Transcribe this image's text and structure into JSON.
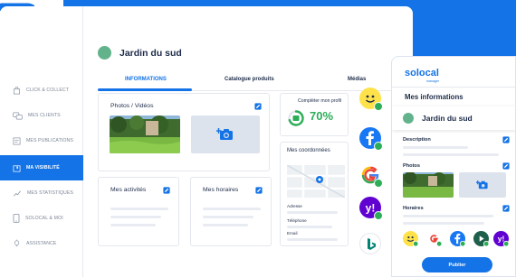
{
  "brand": {
    "accent": "#1473e6",
    "success": "#2cae58",
    "text": "#1d2b48"
  },
  "sidebar": {
    "items": [
      {
        "label": "Click & collect",
        "icon": "shopping-bag-icon"
      },
      {
        "label": "Mes clients",
        "icon": "chat-bubbles-icon"
      },
      {
        "label": "Mes publications",
        "icon": "publication-icon"
      },
      {
        "label": "Ma visibilité",
        "icon": "map-pin-icon",
        "active": true
      },
      {
        "label": "Mes statistiques",
        "icon": "chart-line-icon"
      },
      {
        "label": "Solocal & moi",
        "icon": "phone-icon"
      },
      {
        "label": "Assistance",
        "icon": "lightbulb-icon"
      }
    ]
  },
  "header": {
    "title": "Jardin du sud"
  },
  "tabs": [
    "INFORMATIONS",
    "Catalogue produits",
    "Médias"
  ],
  "cards": {
    "photos": {
      "title": "Photos / Vidéos"
    },
    "activities": {
      "title": "Mes activités"
    },
    "hours": {
      "title": "Mes horaires"
    },
    "profile": {
      "title": "Compléter mon profil",
      "percent": "70%",
      "progress": 0.7
    },
    "contact": {
      "title": "Mes coordonnées",
      "address_label": "Adresse",
      "phone_label": "Téléphone",
      "email_label": "Email"
    }
  },
  "networks": [
    "smiley-icon",
    "facebook-icon",
    "google-icon",
    "yahoo-icon",
    "bing-icon"
  ],
  "phone": {
    "logo": "solocal",
    "logo_sub": "manager",
    "title": "Mes informations",
    "business_name": "Jardin du sud",
    "description_label": "Description",
    "photos_label": "Photos",
    "hours_label": "Horaires",
    "publish_label": "Publier"
  }
}
